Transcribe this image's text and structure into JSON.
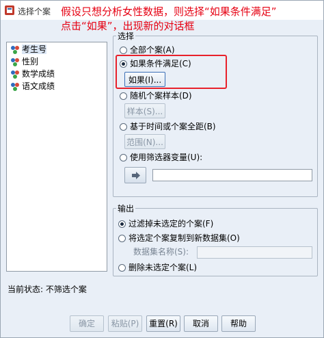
{
  "window": {
    "title": "选择个案"
  },
  "annotation": {
    "line1": "假设只想分析女性数据，则选择“如果条件满足”",
    "line2": "点击“如果”，出现新的对话框"
  },
  "variables": [
    {
      "label": "考生号",
      "icon": "nominal-variable-icon",
      "selected": true
    },
    {
      "label": "性别",
      "icon": "nominal-variable-icon",
      "selected": false
    },
    {
      "label": "数学成绩",
      "icon": "nominal-variable-icon",
      "selected": false
    },
    {
      "label": "语文成绩",
      "icon": "nominal-variable-icon",
      "selected": false
    }
  ],
  "select_group": {
    "legend": "选择",
    "all_cases": "全部个案(A)",
    "if_condition": "如果条件满足(C)",
    "if_button": "如果(I)...",
    "random_sample": "随机个案样本(D)",
    "sample_button": "样本(S)...",
    "range": "基于时间或个案全距(B)",
    "range_button": "范围(N)...",
    "filter_variable": "使用筛选器变量(U):",
    "selected_option": "如果条件满足(C)"
  },
  "output_group": {
    "legend": "输出",
    "filter_out": "过滤掉未选定的个案(F)",
    "copy_to_dataset": "将选定个案复制到新数据集(O)",
    "dataset_name_label": "数据集名称(S):",
    "delete_unselected": "删除未选定个案(L)",
    "selected_option": "过滤掉未选定的个案(F)"
  },
  "status": "当前状态: 不筛选个案",
  "buttons": {
    "ok": "确定",
    "paste": "粘贴(P)",
    "reset": "重置(R)",
    "cancel": "取消",
    "help": "帮助"
  },
  "colors": {
    "annotation": "#e60012",
    "highlight_box": "#e8202a",
    "dialog_bg": "#e9eff7"
  }
}
